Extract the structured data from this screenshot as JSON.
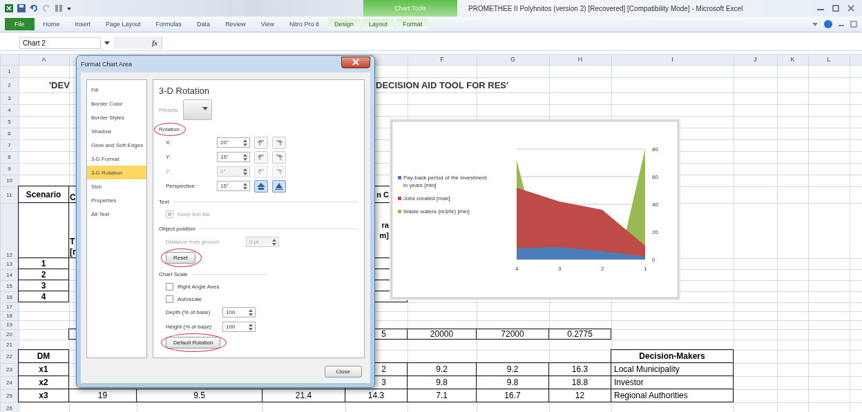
{
  "title_bar": {
    "title": "PROMETHEE II Polyhnitos (version 2) [Recovered]  [Compatibility Mode] - Microsoft Excel",
    "context_group": "Chart Tools"
  },
  "ribbon_tabs": [
    {
      "label": "File",
      "kind": "file"
    },
    {
      "label": "Home",
      "kind": "tab"
    },
    {
      "label": "Insert",
      "kind": "tab"
    },
    {
      "label": "Page Layout",
      "kind": "tab"
    },
    {
      "label": "Formulas",
      "kind": "tab"
    },
    {
      "label": "Data",
      "kind": "tab"
    },
    {
      "label": "Review",
      "kind": "tab"
    },
    {
      "label": "View",
      "kind": "tab"
    },
    {
      "label": "Nitro Pro 8",
      "kind": "tab"
    },
    {
      "label": "Design",
      "kind": "context"
    },
    {
      "label": "Layout",
      "kind": "context"
    },
    {
      "label": "Format",
      "kind": "context"
    }
  ],
  "formula_bar": {
    "name_box": "Chart 2",
    "function_label": "fx"
  },
  "sheet": {
    "column_headers": {
      "A": "A",
      "F": "F",
      "G": "G",
      "H": "H",
      "I": "I",
      "J": "J",
      "K": "K",
      "L": "L"
    },
    "rows": [
      {
        "label": "1"
      },
      {
        "label": "2",
        "cells": {
          "A": {
            "text": "'DEV",
            "kind": "title"
          },
          "E": {
            "text": "DECISION AID TOOL FOR RES'",
            "kind": "title"
          }
        }
      },
      {
        "label": "3"
      },
      {
        "label": "4"
      },
      {
        "label": "5"
      },
      {
        "label": "6"
      },
      {
        "label": "7"
      },
      {
        "label": "8"
      },
      {
        "label": "9"
      },
      {
        "label": "10"
      },
      {
        "label": "11",
        "cells": {
          "A": {
            "text": "Scenario",
            "kind": "heading",
            "boxed": true
          },
          "B": {
            "text": "C",
            "kind": "cut",
            "boxed": true
          },
          "E": {
            "text": "n C",
            "kind": "stub",
            "boxed": true
          }
        }
      },
      {
        "label": "12",
        "cells": {
          "A": {
            "kind": "heading",
            "boxed": true
          },
          "B": {
            "lines": [
              "T",
              "[r"
            ],
            "kind": "cut",
            "boxed": true
          },
          "E": {
            "lines": [
              "ra",
              "m]"
            ],
            "kind": "stub",
            "boxed": true
          }
        }
      },
      {
        "label": "13",
        "cells": {
          "A": {
            "text": "1",
            "kind": "heading",
            "boxed": true
          },
          "E": {
            "kind": "number",
            "boxed": true
          }
        }
      },
      {
        "label": "14",
        "cells": {
          "A": {
            "text": "2",
            "kind": "heading",
            "boxed": true
          },
          "E": {
            "kind": "number",
            "boxed": true
          }
        }
      },
      {
        "label": "15",
        "cells": {
          "A": {
            "text": "3",
            "kind": "heading",
            "boxed": true
          },
          "E": {
            "kind": "number",
            "boxed": true
          }
        }
      },
      {
        "label": "16",
        "cells": {
          "A": {
            "text": "4",
            "kind": "heading",
            "boxed": true
          },
          "E": {
            "kind": "number",
            "boxed": true
          }
        }
      },
      {
        "label": "17"
      },
      {
        "label": "18"
      },
      {
        "label": "19"
      },
      {
        "label": "20",
        "cells": {
          "B": {
            "kind": "number",
            "boxed": true
          },
          "E": {
            "text": "5",
            "kind": "tail",
            "boxed": true
          },
          "F": {
            "text": "20000",
            "kind": "number",
            "boxed": true
          },
          "G": {
            "text": "72000",
            "kind": "number",
            "boxed": true
          },
          "H": {
            "text": "0.2775",
            "kind": "number",
            "boxed": true
          }
        }
      },
      {
        "label": "21"
      },
      {
        "label": "22",
        "cells": {
          "A": {
            "text": "DM",
            "kind": "heading",
            "boxed": true
          },
          "I": {
            "text": "Decision-Makers",
            "kind": "heading",
            "boxed": true
          }
        }
      },
      {
        "label": "23",
        "cells": {
          "A": {
            "text": "x1",
            "kind": "heading",
            "boxed": true
          },
          "E": {
            "text": "2",
            "kind": "tail",
            "boxed": true
          },
          "F": {
            "text": "9.2",
            "kind": "number",
            "boxed": true
          },
          "G": {
            "text": "9.2",
            "kind": "number",
            "boxed": true
          },
          "H": {
            "text": "16.3",
            "kind": "number",
            "boxed": true
          },
          "I": {
            "text": "Local Municipality",
            "kind": "text",
            "boxed": true
          }
        }
      },
      {
        "label": "24",
        "cells": {
          "A": {
            "text": "x2",
            "kind": "heading",
            "boxed": true
          },
          "E": {
            "text": "3",
            "kind": "tail",
            "boxed": true
          },
          "F": {
            "text": "9.8",
            "kind": "number",
            "boxed": true
          },
          "G": {
            "text": "9.8",
            "kind": "number",
            "boxed": true
          },
          "H": {
            "text": "18.8",
            "kind": "number",
            "boxed": true
          },
          "I": {
            "text": "Investor",
            "kind": "text",
            "boxed": true
          }
        }
      },
      {
        "label": "25",
        "cells": {
          "A": {
            "text": "x3",
            "kind": "heading",
            "boxed": true
          },
          "B": {
            "text": "19",
            "kind": "number",
            "boxed": true
          },
          "C": {
            "text": "9.5",
            "kind": "number",
            "boxed": true
          },
          "D": {
            "text": "21.4",
            "kind": "number",
            "boxed": true
          },
          "E": {
            "text": "14.3",
            "kind": "number",
            "boxed": true
          },
          "F": {
            "text": "7.1",
            "kind": "number",
            "boxed": true
          },
          "G": {
            "text": "16.7",
            "kind": "number",
            "boxed": true
          },
          "H": {
            "text": "12",
            "kind": "number",
            "boxed": true
          },
          "I": {
            "text": "Regional Authorities",
            "kind": "text",
            "boxed": true
          }
        }
      },
      {
        "label": "26"
      }
    ]
  },
  "chart": {
    "chart_data": {
      "type": "area",
      "categories": [
        "4",
        "3",
        "2",
        "1"
      ],
      "yticks": [
        0,
        20,
        40,
        60,
        80
      ],
      "ylim": [
        0,
        80
      ],
      "grid": true,
      "series": [
        {
          "name": "Pay-back period of the investment in years [min]",
          "color": "#4a7ebb",
          "values": [
            8,
            9,
            6,
            2
          ]
        },
        {
          "name": "Jobs created [max]",
          "color": "#be4b48",
          "values": [
            52,
            42,
            36,
            10
          ]
        },
        {
          "name": "Waste waters (m3/hr) [min]",
          "color": "#98b954",
          "values": [
            72,
            null,
            null,
            80
          ]
        }
      ]
    }
  },
  "dialog": {
    "title": "Format Chart Area",
    "categories": [
      {
        "label": "Fill",
        "selected": false
      },
      {
        "label": "Border Color",
        "selected": false
      },
      {
        "label": "Border Styles",
        "selected": false
      },
      {
        "label": "Shadow",
        "selected": false
      },
      {
        "label": "Glow and Soft Edges",
        "selected": false
      },
      {
        "label": "3-D Format",
        "selected": false
      },
      {
        "label": "3-D Rotation",
        "selected": true
      },
      {
        "label": "Size",
        "selected": false
      },
      {
        "label": "Properties",
        "selected": false
      },
      {
        "label": "Alt Text",
        "selected": false
      }
    ],
    "heading": "3-D Rotation",
    "presets_label": "Presets:",
    "rotation": {
      "label": "Rotation",
      "highlighted": true,
      "fields": [
        {
          "label": "X:",
          "value": "20°",
          "disabled": false,
          "kind": "rotation"
        },
        {
          "label": "Y:",
          "value": "15°",
          "disabled": false,
          "kind": "tilt"
        },
        {
          "label": "Z:",
          "value": "0°",
          "disabled": true,
          "kind": "rotation"
        },
        {
          "label": "Perspective:",
          "value": "15°",
          "disabled": false,
          "kind": "perspective"
        }
      ]
    },
    "text_section": {
      "label": "Text",
      "checkbox": {
        "label": "Keep text flat",
        "checked": true,
        "disabled": true
      }
    },
    "object_position": {
      "label": "Object position",
      "field_label": "Distance from ground:",
      "value": "0 pt",
      "disabled": true,
      "reset": {
        "label": "Reset",
        "highlighted": true
      }
    },
    "chart_scale": {
      "label": "Chart Scale",
      "checkboxes": [
        {
          "label": "Right Angle Axes",
          "checked": false,
          "disabled": false
        },
        {
          "label": "Autoscale",
          "checked": false,
          "disabled": false
        }
      ],
      "fields": [
        {
          "label": "Depth (% of base)",
          "value": "100"
        },
        {
          "label": "Height (% of base)",
          "value": "100"
        }
      ],
      "default_button": {
        "label": "Default Rotation",
        "highlighted": true
      }
    },
    "close_label": "Close"
  }
}
